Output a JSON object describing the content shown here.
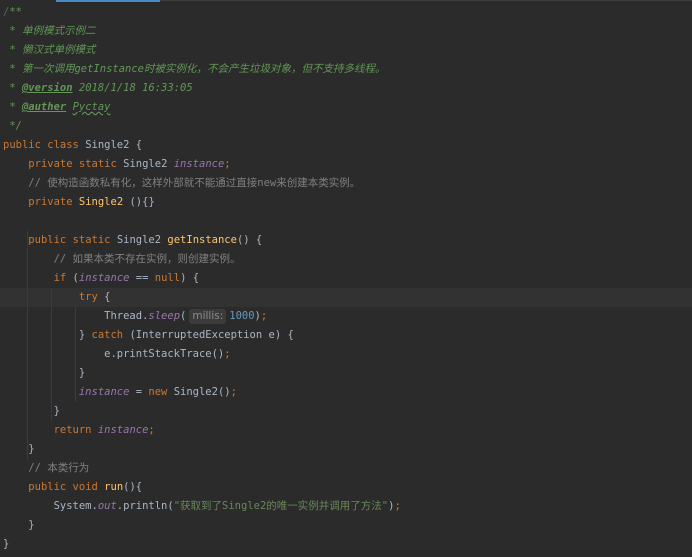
{
  "lines": [
    {
      "id": "l1",
      "segs": [
        [
          "fold",
          "/"
        ],
        [
          "doc",
          "**"
        ]
      ]
    },
    {
      "id": "l2",
      "segs": [
        [
          "doc",
          " * 单例模式示例二"
        ]
      ]
    },
    {
      "id": "l3",
      "segs": [
        [
          "doc",
          " * 懒汉式单例模式"
        ]
      ]
    },
    {
      "id": "l4",
      "segs": [
        [
          "doc",
          " * 第一次调用getInstance时被实例化，不会产生垃圾对象，但不支持多线程。"
        ]
      ]
    },
    {
      "id": "l5",
      "segs": [
        [
          "doc",
          " * "
        ],
        [
          "doc-tag",
          "@version"
        ],
        [
          "doc-val",
          " 2018/1/18 16:33:05"
        ]
      ]
    },
    {
      "id": "l6",
      "segs": [
        [
          "doc",
          " * "
        ],
        [
          "doc-tag",
          "@auther"
        ],
        [
          "doc-val",
          " "
        ],
        [
          "doc-under",
          "Pyctay"
        ]
      ]
    },
    {
      "id": "l7",
      "segs": [
        [
          "doc",
          " */"
        ]
      ]
    },
    {
      "id": "l8",
      "segs": [
        [
          "kw",
          "public"
        ],
        [
          "plain",
          " "
        ],
        [
          "kw",
          "class"
        ],
        [
          "plain",
          " Single2 {"
        ]
      ]
    },
    {
      "id": "l9",
      "segs": [
        [
          "plain",
          "    "
        ],
        [
          "kw",
          "private static"
        ],
        [
          "plain",
          " Single2 "
        ],
        [
          "fld",
          "instance"
        ],
        [
          "kw",
          ";"
        ]
      ]
    },
    {
      "id": "l10",
      "segs": [
        [
          "plain",
          "    "
        ],
        [
          "cmt",
          "// 使构造函数私有化，这样外部就不能通过直接new来创建本类实例。"
        ]
      ]
    },
    {
      "id": "l11",
      "segs": [
        [
          "plain",
          "    "
        ],
        [
          "kw",
          "private"
        ],
        [
          "plain",
          " "
        ],
        [
          "fn",
          "Single2"
        ],
        [
          "plain",
          " (){}"
        ]
      ]
    },
    {
      "id": "l12",
      "segs": [
        [
          "plain",
          ""
        ]
      ]
    },
    {
      "id": "l13",
      "segs": [
        [
          "plain",
          "    "
        ],
        [
          "kw",
          "public"
        ],
        [
          "plain",
          " "
        ],
        [
          "kw",
          "static"
        ],
        [
          "plain",
          " Single2 "
        ],
        [
          "fn",
          "getInstance"
        ],
        [
          "plain",
          "() {"
        ]
      ]
    },
    {
      "id": "l14",
      "segs": [
        [
          "plain",
          "        "
        ],
        [
          "cmt",
          "// 如果本类不存在实例，则创建实例。"
        ]
      ]
    },
    {
      "id": "l15",
      "segs": [
        [
          "plain",
          "        "
        ],
        [
          "kw",
          "if"
        ],
        [
          "plain",
          " ("
        ],
        [
          "fld",
          "instance"
        ],
        [
          "plain",
          " == "
        ],
        [
          "kw",
          "null"
        ],
        [
          "plain",
          ") {"
        ]
      ]
    },
    {
      "id": "l16",
      "segs": [
        [
          "plain",
          "            "
        ],
        [
          "kw",
          "try"
        ],
        [
          "plain",
          " {"
        ]
      ],
      "caret": true
    },
    {
      "id": "l17",
      "segs": [
        [
          "plain",
          "                Thread."
        ],
        [
          "sfld",
          "sleep"
        ],
        [
          "plain",
          "("
        ],
        [
          "hint",
          "millis:"
        ],
        [
          "num",
          "1000"
        ],
        [
          "plain",
          ")"
        ],
        [
          "kw",
          ";"
        ]
      ]
    },
    {
      "id": "l18",
      "segs": [
        [
          "plain",
          "            } "
        ],
        [
          "kw",
          "catch"
        ],
        [
          "plain",
          " (InterruptedException e) {"
        ]
      ]
    },
    {
      "id": "l19",
      "segs": [
        [
          "plain",
          "                e.printStackTrace()"
        ],
        [
          "kw",
          ";"
        ]
      ]
    },
    {
      "id": "l20",
      "segs": [
        [
          "plain",
          "            }"
        ]
      ]
    },
    {
      "id": "l21",
      "segs": [
        [
          "plain",
          "            "
        ],
        [
          "fld",
          "instance"
        ],
        [
          "plain",
          " = "
        ],
        [
          "kw",
          "new"
        ],
        [
          "plain",
          " Single2()"
        ],
        [
          "kw",
          ";"
        ]
      ]
    },
    {
      "id": "l22",
      "segs": [
        [
          "plain",
          "        }"
        ]
      ]
    },
    {
      "id": "l23",
      "segs": [
        [
          "plain",
          "        "
        ],
        [
          "kw",
          "return"
        ],
        [
          "plain",
          " "
        ],
        [
          "fld",
          "instance"
        ],
        [
          "kw",
          ";"
        ]
      ]
    },
    {
      "id": "l24",
      "segs": [
        [
          "plain",
          "    }"
        ]
      ]
    },
    {
      "id": "l25",
      "segs": [
        [
          "plain",
          "    "
        ],
        [
          "cmt",
          "// 本类行为"
        ]
      ]
    },
    {
      "id": "l26",
      "segs": [
        [
          "plain",
          "    "
        ],
        [
          "kw",
          "public void"
        ],
        [
          "plain",
          " "
        ],
        [
          "fn",
          "run"
        ],
        [
          "plain",
          "(){"
        ]
      ]
    },
    {
      "id": "l27",
      "segs": [
        [
          "plain",
          "        System."
        ],
        [
          "sfld",
          "out"
        ],
        [
          "plain",
          ".println("
        ],
        [
          "str",
          "\"获取到了Single2的唯一实例并调用了方法\""
        ],
        [
          "plain",
          ")"
        ],
        [
          "kw",
          ";"
        ]
      ]
    },
    {
      "id": "l28",
      "segs": [
        [
          "plain",
          "    }"
        ]
      ]
    },
    {
      "id": "l29",
      "segs": [
        [
          "plain",
          "}"
        ]
      ]
    }
  ]
}
